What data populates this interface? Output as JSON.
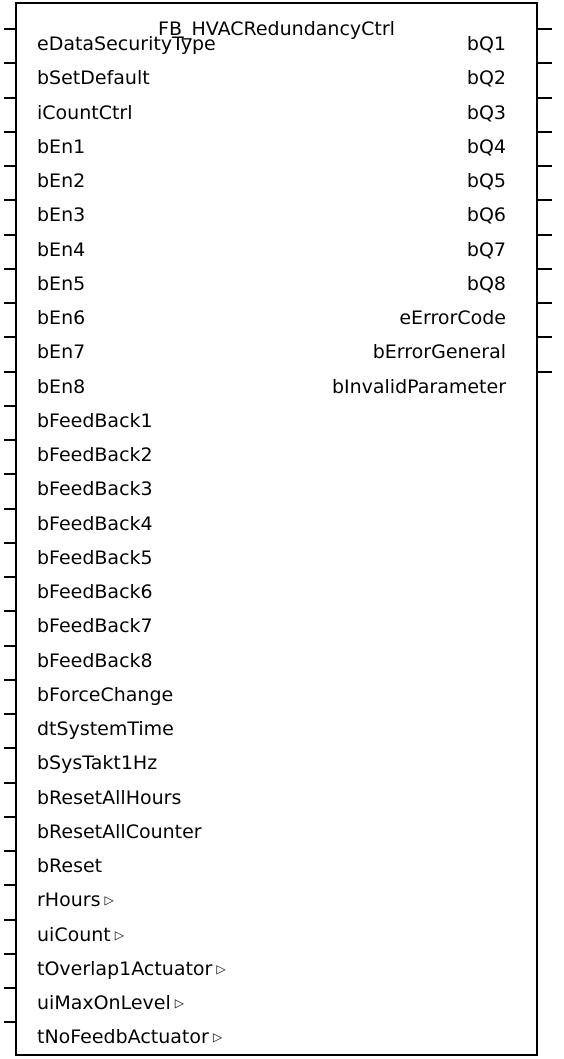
{
  "block": {
    "title": "FB_HVACRedundancyCtrl",
    "inputs": [
      {
        "label": "eDataSecurityType"
      },
      {
        "label": "bSetDefault"
      },
      {
        "label": "iCountCtrl"
      },
      {
        "label": "bEn1"
      },
      {
        "label": "bEn2"
      },
      {
        "label": "bEn3"
      },
      {
        "label": "bEn4"
      },
      {
        "label": "bEn5"
      },
      {
        "label": "bEn6"
      },
      {
        "label": "bEn7"
      },
      {
        "label": "bEn8"
      },
      {
        "label": "bFeedBack1"
      },
      {
        "label": "bFeedBack2"
      },
      {
        "label": "bFeedBack3"
      },
      {
        "label": "bFeedBack4"
      },
      {
        "label": "bFeedBack5"
      },
      {
        "label": "bFeedBack6"
      },
      {
        "label": "bFeedBack7"
      },
      {
        "label": "bFeedBack8"
      },
      {
        "label": "bForceChange"
      },
      {
        "label": "dtSystemTime"
      },
      {
        "label": "bSysTakt1Hz"
      },
      {
        "label": "bResetAllHours"
      },
      {
        "label": "bResetAllCounter"
      },
      {
        "label": "bReset"
      },
      {
        "label": "rHours",
        "in_out": true
      },
      {
        "label": "uiCount",
        "in_out": true
      },
      {
        "label": "tOverlap1Actuator",
        "in_out": true
      },
      {
        "label": "uiMaxOnLevel",
        "in_out": true
      },
      {
        "label": "tNoFeedbActuator",
        "in_out": true
      }
    ],
    "outputs": [
      {
        "label": "bQ1"
      },
      {
        "label": "bQ2"
      },
      {
        "label": "bQ3"
      },
      {
        "label": "bQ4"
      },
      {
        "label": "bQ5"
      },
      {
        "label": "bQ6"
      },
      {
        "label": "bQ7"
      },
      {
        "label": "bQ8"
      },
      {
        "label": "eErrorCode"
      },
      {
        "label": "bErrorGeneral"
      },
      {
        "label": "bInvalidParameter"
      }
    ],
    "in_out_marker": "▷"
  }
}
